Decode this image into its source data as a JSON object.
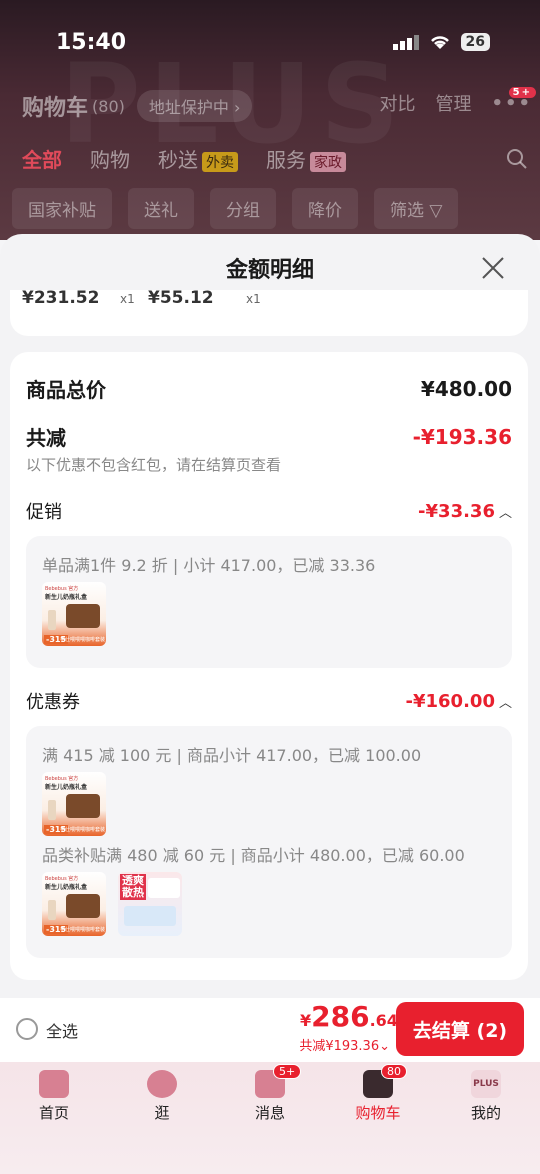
{
  "status": {
    "time": "15:40",
    "battery": "26"
  },
  "header": {
    "title": "购物车",
    "count": "(80)",
    "address": "地址保护中",
    "compare": "对比",
    "manage": "管理",
    "more_badge": "5+",
    "tabs": [
      {
        "label": "全部"
      },
      {
        "label": "购物"
      },
      {
        "label": "秒送",
        "tag": "外卖"
      },
      {
        "label": "服务",
        "tag": "家政"
      }
    ],
    "chips": [
      "国家补贴",
      "送礼",
      "分组",
      "降价",
      "筛选"
    ]
  },
  "sheet": {
    "title": "金额明细",
    "top_items": [
      {
        "price": "¥231.52",
        "qty": "x1"
      },
      {
        "price": "¥55.12",
        "qty": "x1"
      }
    ],
    "total_label": "商品总价",
    "total_value": "¥480.00",
    "discount_label": "共减",
    "discount_value": "-¥193.36",
    "discount_note": "以下优惠不包含红包，请在结算页查看",
    "promo": {
      "label": "促销",
      "value": "-¥33.36",
      "line": "单品满1件 9.2 折 | 小计 417.00，已减 33.36"
    },
    "coupon": {
      "label": "优惠券",
      "value": "-¥160.00",
      "line1": "满 415 减 100 元 | 商品小计 417.00，已减 100.00",
      "line2": "品类补贴满 480 减 60 元 | 商品小计 480.00，已减 60.00"
    },
    "thumb_a": {
      "t1": "Bebebus 官方",
      "t2": "新生儿奶瓶礼盒",
      "price": "-315",
      "foot": "学仕喂喂喂咖啡套装"
    },
    "thumb_b": {
      "t1": "透爽散热",
      "brand": "亲肤透气纸尿裤"
    }
  },
  "bottom": {
    "select_all": "全选",
    "yen": "¥",
    "total_int": "286",
    "total_dec": ".64",
    "total_sub": "共减¥193.36",
    "checkout": "去结算 (2)"
  },
  "nav": [
    {
      "label": "首页"
    },
    {
      "label": "逛"
    },
    {
      "label": "消息",
      "badge": "5+"
    },
    {
      "label": "购物车",
      "badge": "80"
    },
    {
      "label": "我的",
      "icon_text": "PLUS"
    }
  ]
}
